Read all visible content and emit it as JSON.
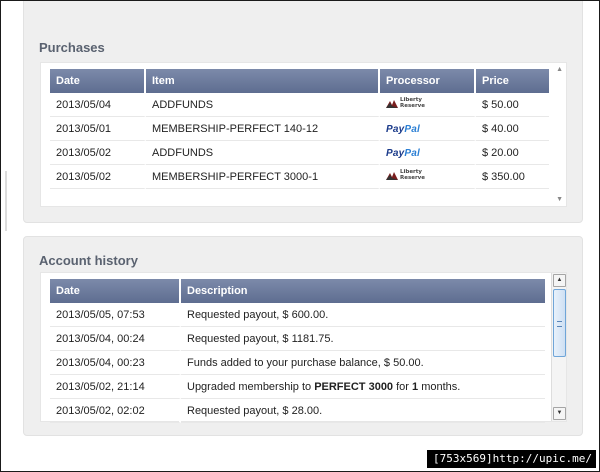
{
  "purchases": {
    "title": "Purchases",
    "columns": [
      "Date",
      "Item",
      "Processor",
      "Price"
    ],
    "rows": [
      {
        "date": "2013/05/04",
        "item": "ADDFUNDS",
        "processor": "Liberty Reserve",
        "price": "$ 50.00"
      },
      {
        "date": "2013/05/01",
        "item": "MEMBERSHIP-PERFECT 140-12",
        "processor": "PayPal",
        "price": "$ 40.00"
      },
      {
        "date": "2013/05/02",
        "item": "ADDFUNDS",
        "processor": "PayPal",
        "price": "$ 20.00"
      },
      {
        "date": "2013/05/02",
        "item": "MEMBERSHIP-PERFECT 3000-1",
        "processor": "Liberty Reserve",
        "price": "$ 350.00"
      }
    ]
  },
  "history": {
    "title": "Account history",
    "columns": [
      "Date",
      "Description"
    ],
    "rows": [
      {
        "date": "2013/05/05, 07:53",
        "desc_pre": "Requested payout, $ 600.00."
      },
      {
        "date": "2013/05/04, 00:24",
        "desc_pre": "Requested payout, $ 1181.75."
      },
      {
        "date": "2013/05/04, 00:23",
        "desc_pre": "Funds added to your purchase balance, $ 50.00."
      },
      {
        "date": "2013/05/02, 21:14",
        "desc_pre": "Upgraded membership to ",
        "desc_bold1": "PERFECT 3000",
        "desc_mid": " for ",
        "desc_bold2": "1",
        "desc_post": " months."
      },
      {
        "date": "2013/05/02, 02:02",
        "desc_pre": "Requested payout, $ 28.00."
      }
    ]
  },
  "processor_labels": {
    "liberty_line1": "Liberty",
    "liberty_line2": "Reserve",
    "paypal_pay": "Pay",
    "paypal_pal": "Pal"
  },
  "watermark": "[753x569]http://upic.me/"
}
